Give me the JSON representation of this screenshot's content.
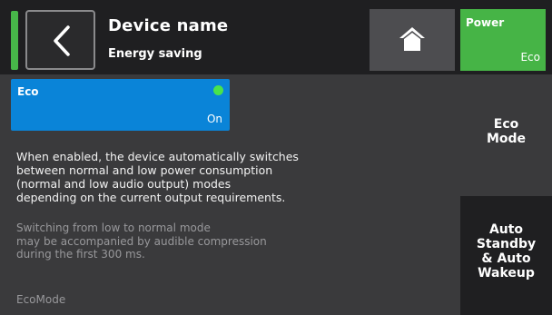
{
  "header": {
    "title": "Device name",
    "subtitle": "Energy saving",
    "back_icon": "chevron-left-icon",
    "home_icon": "home-icon",
    "accent_color": "#47b749"
  },
  "power": {
    "label": "Power",
    "value": "Eco",
    "color": "#46b446"
  },
  "eco_card": {
    "label": "Eco",
    "value": "On",
    "indicator_color": "#49e34c",
    "color": "#0a84d8"
  },
  "description": {
    "lines": [
      "When enabled, the device automatically switches",
      "between normal and low power consumption",
      "(normal and low audio output) modes",
      "depending on the current output requirements."
    ]
  },
  "note": {
    "lines": [
      "Switching from low to normal mode",
      "may be accompanied by audible compression",
      "during the first 300 ms."
    ]
  },
  "footer": {
    "label": "EcoMode"
  },
  "side_tabs": [
    {
      "lines": [
        "Eco",
        "Mode"
      ]
    },
    {
      "lines": [
        "Auto",
        "Standby",
        "& Auto",
        "Wakeup"
      ]
    }
  ]
}
